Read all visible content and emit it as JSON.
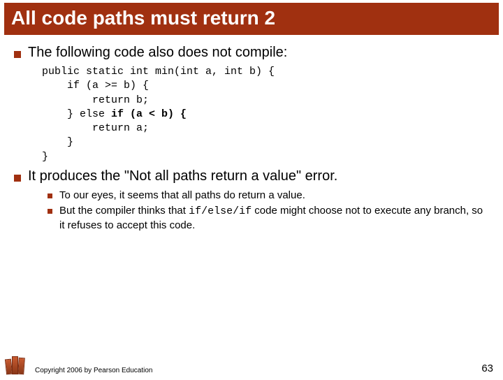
{
  "title": "All code paths must return 2",
  "bullet1": "The following code also does not compile:",
  "code": {
    "l1": "public static int min(int a, int b) {",
    "l2": "    if (a >= b) {",
    "l3": "        return b;",
    "l4a": "    } else ",
    "l4b": "if (a < b) {",
    "l5": "        return a;",
    "l6": "    }",
    "l7": "}"
  },
  "bullet2": "It produces the \"Not all paths return a value\" error.",
  "sub1": "To our eyes, it seems that all paths do return a value.",
  "sub2a": "But the compiler thinks that ",
  "sub2_code": "if/else/if",
  "sub2b": " code might choose not to execute any branch, so it refuses to accept this code.",
  "copyright": "Copyright 2006 by Pearson Education",
  "page": "63"
}
